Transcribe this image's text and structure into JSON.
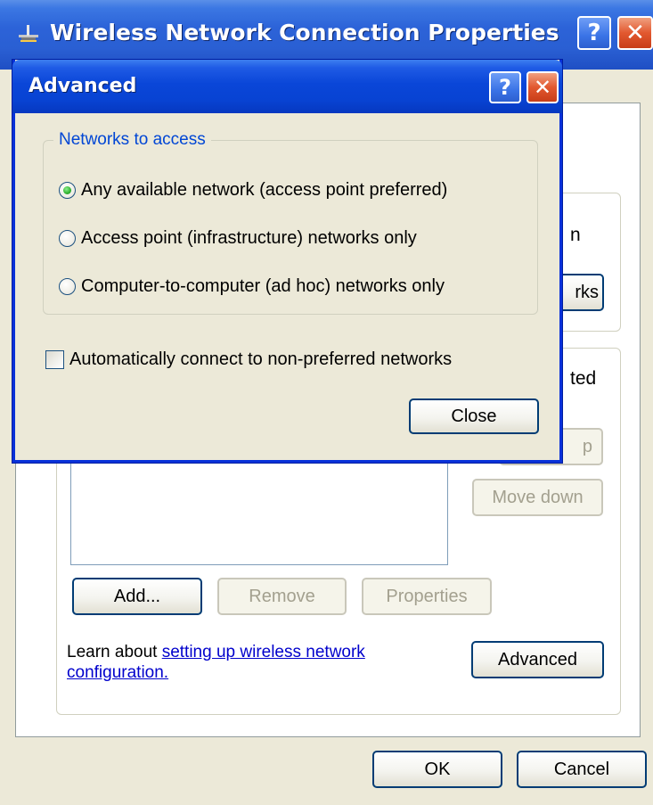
{
  "background_window": {
    "title": "Wireless Network Connection Properties",
    "help_glyph": "?",
    "close_glyph": "✕",
    "partial_networks_label": "rks",
    "partial_on_text": "n",
    "partial_ted_text": "ted",
    "move_up_partial": "p",
    "move_down_label": "Move down",
    "add_label": "Add...",
    "remove_label": "Remove",
    "properties_label": "Properties",
    "learn_text_prefix": "Learn about ",
    "learn_link": "setting up wireless network configuration.",
    "advanced_label": "Advanced",
    "ok_label": "OK",
    "cancel_label": "Cancel",
    "icons": {
      "app": "wireless-network-icon"
    }
  },
  "advanced_dialog": {
    "title": "Advanced",
    "help_glyph": "?",
    "close_glyph": "✕",
    "group_title": "Networks to access",
    "options": [
      {
        "label": "Any available network (access point preferred)",
        "checked": true
      },
      {
        "label": "Access point (infrastructure) networks only",
        "checked": false
      },
      {
        "label": "Computer-to-computer (ad hoc) networks only",
        "checked": false
      }
    ],
    "auto_connect_label": "Automatically connect to non-preferred networks",
    "auto_connect_checked": false,
    "close_label": "Close"
  },
  "colors": {
    "titlebar_blue": "#0843d3",
    "dialog_face": "#ece9d8",
    "group_title_blue": "#0046d5",
    "close_red": "#e2582f"
  }
}
